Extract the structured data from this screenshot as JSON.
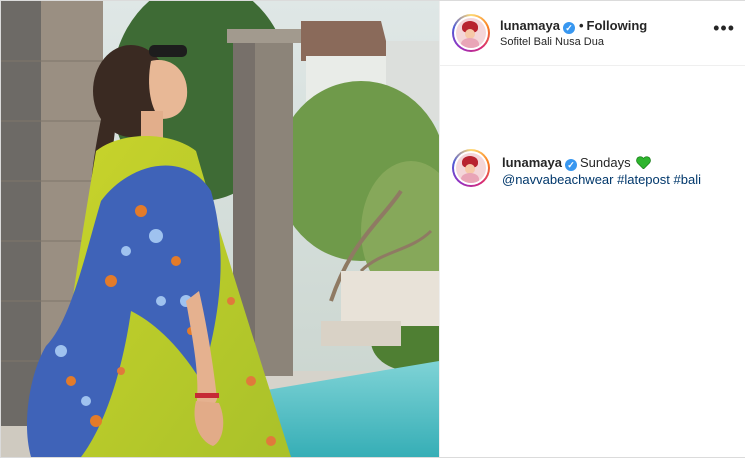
{
  "post": {
    "username": "lunamaya",
    "verified_glyph": "✓",
    "separator": "•",
    "follow_status": "Following",
    "location": "Sofitel Bali Nusa Dua",
    "more_glyph": "•••",
    "photo_icon": "photo-of-woman-in-floral-kaftan-by-pool"
  },
  "caption": {
    "username": "lunamaya",
    "verified_glyph": "✓",
    "text": "Sundays",
    "emoji": "green-heart",
    "mention": "@navvabeachwear",
    "tag1": "#latepost",
    "tag2": "#bali"
  },
  "colors": {
    "verified": "#3897f0",
    "link": "#00376b",
    "heart": "#2db42d"
  }
}
